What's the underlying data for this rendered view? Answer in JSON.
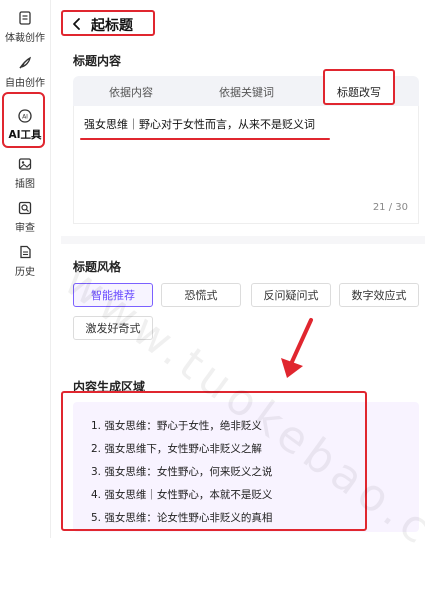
{
  "sidebar": {
    "items": [
      {
        "label": "体裁创作",
        "icon": "document-icon"
      },
      {
        "label": "自由创作",
        "icon": "feather-icon"
      },
      {
        "label": "AI工具",
        "icon": "ai-icon",
        "active": true
      },
      {
        "label": "插图",
        "icon": "image-icon"
      },
      {
        "label": "审查",
        "icon": "review-icon"
      },
      {
        "label": "历史",
        "icon": "history-icon"
      }
    ]
  },
  "header": {
    "title": "起标题"
  },
  "content_section": {
    "title": "标题内容",
    "tabs": [
      {
        "label": "依据内容"
      },
      {
        "label": "依据关键词"
      },
      {
        "label": "标题改写",
        "active": true
      }
    ],
    "editor_text": "强女思维｜野心对于女性而言，从来不是贬义词",
    "char_count": "21 / 30"
  },
  "style_section": {
    "title": "标题风格",
    "options": [
      {
        "label": "智能推荐",
        "selected": true
      },
      {
        "label": "恐慌式"
      },
      {
        "label": "反问疑问式"
      },
      {
        "label": "数字效应式"
      },
      {
        "label": "激发好奇式"
      }
    ]
  },
  "result_section": {
    "title": "内容生成区域",
    "items": [
      "1. 强女思维：野心于女性，绝非贬义",
      "2. 强女思维下，女性野心非贬义之解",
      "3. 强女思维：女性野心，何来贬义之说",
      "4. 强女思维｜女性野心，本就不是贬义",
      "5. 强女思维：论女性野心非贬义的真相"
    ]
  },
  "watermark": "www.tuokebao.com",
  "colors": {
    "accent": "#7b61ff",
    "annotation": "#e0262f",
    "result_bg": "#f8f3ff"
  }
}
